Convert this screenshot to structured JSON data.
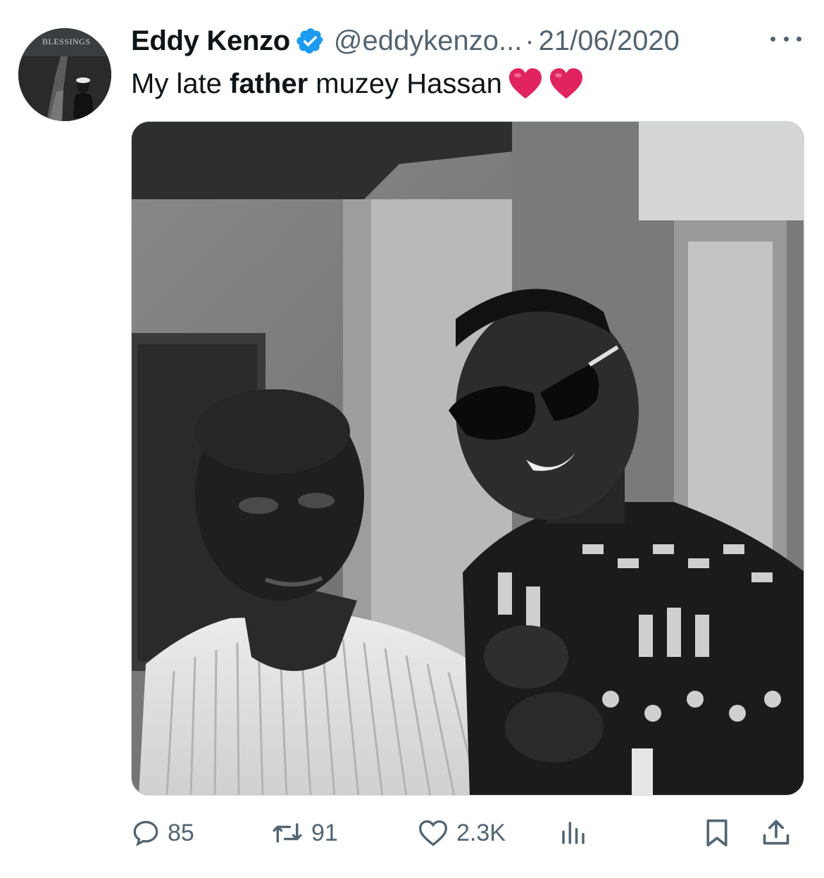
{
  "tweet": {
    "author": {
      "display_name": "Eddy Kenzo",
      "handle": "@eddykenzo...",
      "verified": true,
      "avatar_text": "BLESSINGS"
    },
    "separator": "·",
    "date": "21/06/2020",
    "text": {
      "before": "My late ",
      "bold": "father",
      "after": " muzey Hassan",
      "emoji": [
        "heart",
        "heart"
      ]
    },
    "stats": {
      "replies": "85",
      "reposts": "91",
      "likes": "2.3K"
    }
  },
  "icons": {
    "more": "more-dots-icon",
    "verified": "verified-badge-icon",
    "reply": "reply-bubble-icon",
    "repost": "repost-icon",
    "like": "heart-outline-icon",
    "views": "views-bar-chart-icon",
    "bookmark": "bookmark-icon",
    "share": "share-upload-icon"
  },
  "colors": {
    "text_primary": "#0f1419",
    "text_secondary": "#536471",
    "verified_blue": "#1d9bf0",
    "heart_red": "#e0245e"
  }
}
